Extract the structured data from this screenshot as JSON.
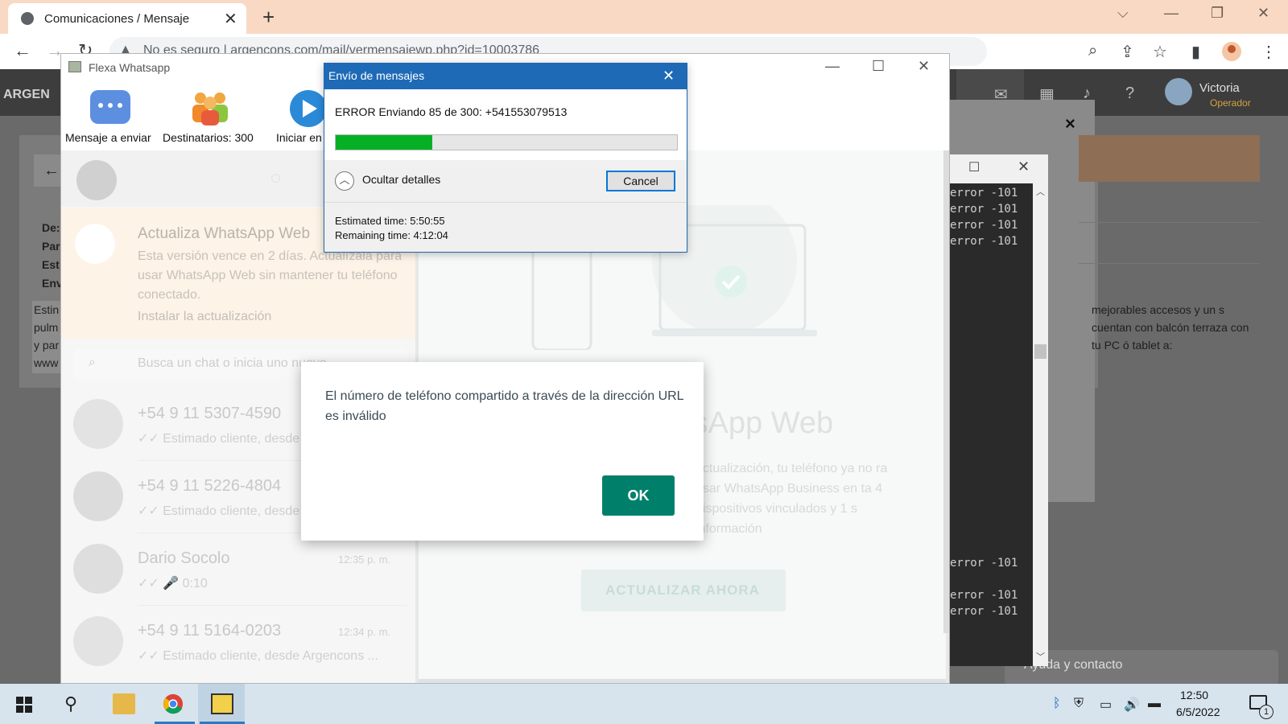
{
  "browser": {
    "tab_title": "Comunicaciones / Mensaje",
    "tab_close": "✕",
    "new_tab": "+",
    "url_security": "No es seguro",
    "url": "argencons.com/mail/vermensajewp.php?id=10003786",
    "controls": {
      "minimize": "—",
      "restore": "❐",
      "close": "✕",
      "tablist": "⌵"
    }
  },
  "site": {
    "logo": "ARGEN",
    "user_name": "Victoria",
    "user_role": "Operador",
    "left_labels": [
      "De:",
      "Par",
      "Est",
      "Env"
    ],
    "left_text": "Estin pulm y par www",
    "right_text": "mejorables accesos y un s cuentan con balcón terraza con tu PC ó tablet a:",
    "close": "×",
    "help": "Ayuda y contacto"
  },
  "console": {
    "lines_top": [
      "error -101",
      "error -101",
      "error -101",
      "error -101"
    ],
    "lines_bottom": [
      "error -101",
      "error -101",
      "error -101"
    ]
  },
  "flexa": {
    "title": "Flexa Whatsapp",
    "tools": [
      {
        "label": "Mensaje a enviar",
        "icon": "message-bubbles-icon"
      },
      {
        "label": "Destinatarios: 300",
        "icon": "recipients-group-icon"
      },
      {
        "label": "Iniciar en",
        "icon": "play-icon"
      }
    ]
  },
  "whatsapp": {
    "banner_title": "Actualiza WhatsApp Web",
    "banner_text": "Esta versión vence en 2 días. Actualízala para usar WhatsApp Web sin mantener tu teléfono conectado.",
    "banner_link": "Instalar la actualización",
    "search_placeholder": "Busca un chat o inicia uno nuevo",
    "chats": [
      {
        "name": "+54 9 11 5307-4590",
        "preview": "✓✓ Estimado cliente, desde",
        "time": ""
      },
      {
        "name": "+54 9 11 5226-4804",
        "preview": "✓✓ Estimado cliente, desde",
        "time": ""
      },
      {
        "name": "Dario Socolo",
        "preview": "✓✓ 🎤 0:10",
        "time": "12:35 p. m."
      },
      {
        "name": "+54 9 11 5164-0203",
        "preview": "✓✓ Estimado cliente, desde Argencons ...",
        "time": "12:34 p. m."
      }
    ],
    "main_title": "tsApp Web",
    "main_desc": "actualización, tu teléfono ya no ra usar WhatsApp Business en ta 4 dispositivos vinculados y 1 s información",
    "update_button": "ACTUALIZAR AHORA"
  },
  "progress_dialog": {
    "title": "Envío de mensajes",
    "error_text": "ERROR Enviando 85 de 300: +541553079513",
    "progress_fraction": 0.283,
    "details_label": "Ocultar detalles",
    "cancel_label": "Cancel",
    "estimated": "Estimated time: 5:50:55",
    "remaining": "Remaining time: 4:12:04"
  },
  "alert": {
    "message": "El número de teléfono compartido a través de la dirección URL es inválido",
    "ok_label": "OK"
  },
  "taskbar": {
    "time": "12:50",
    "date": "6/5/2022",
    "notifications": "1"
  },
  "colors": {
    "progress_green": "#06b025",
    "dialog_title_blue": "#1e6ab6",
    "whatsapp_green": "#00806a"
  }
}
